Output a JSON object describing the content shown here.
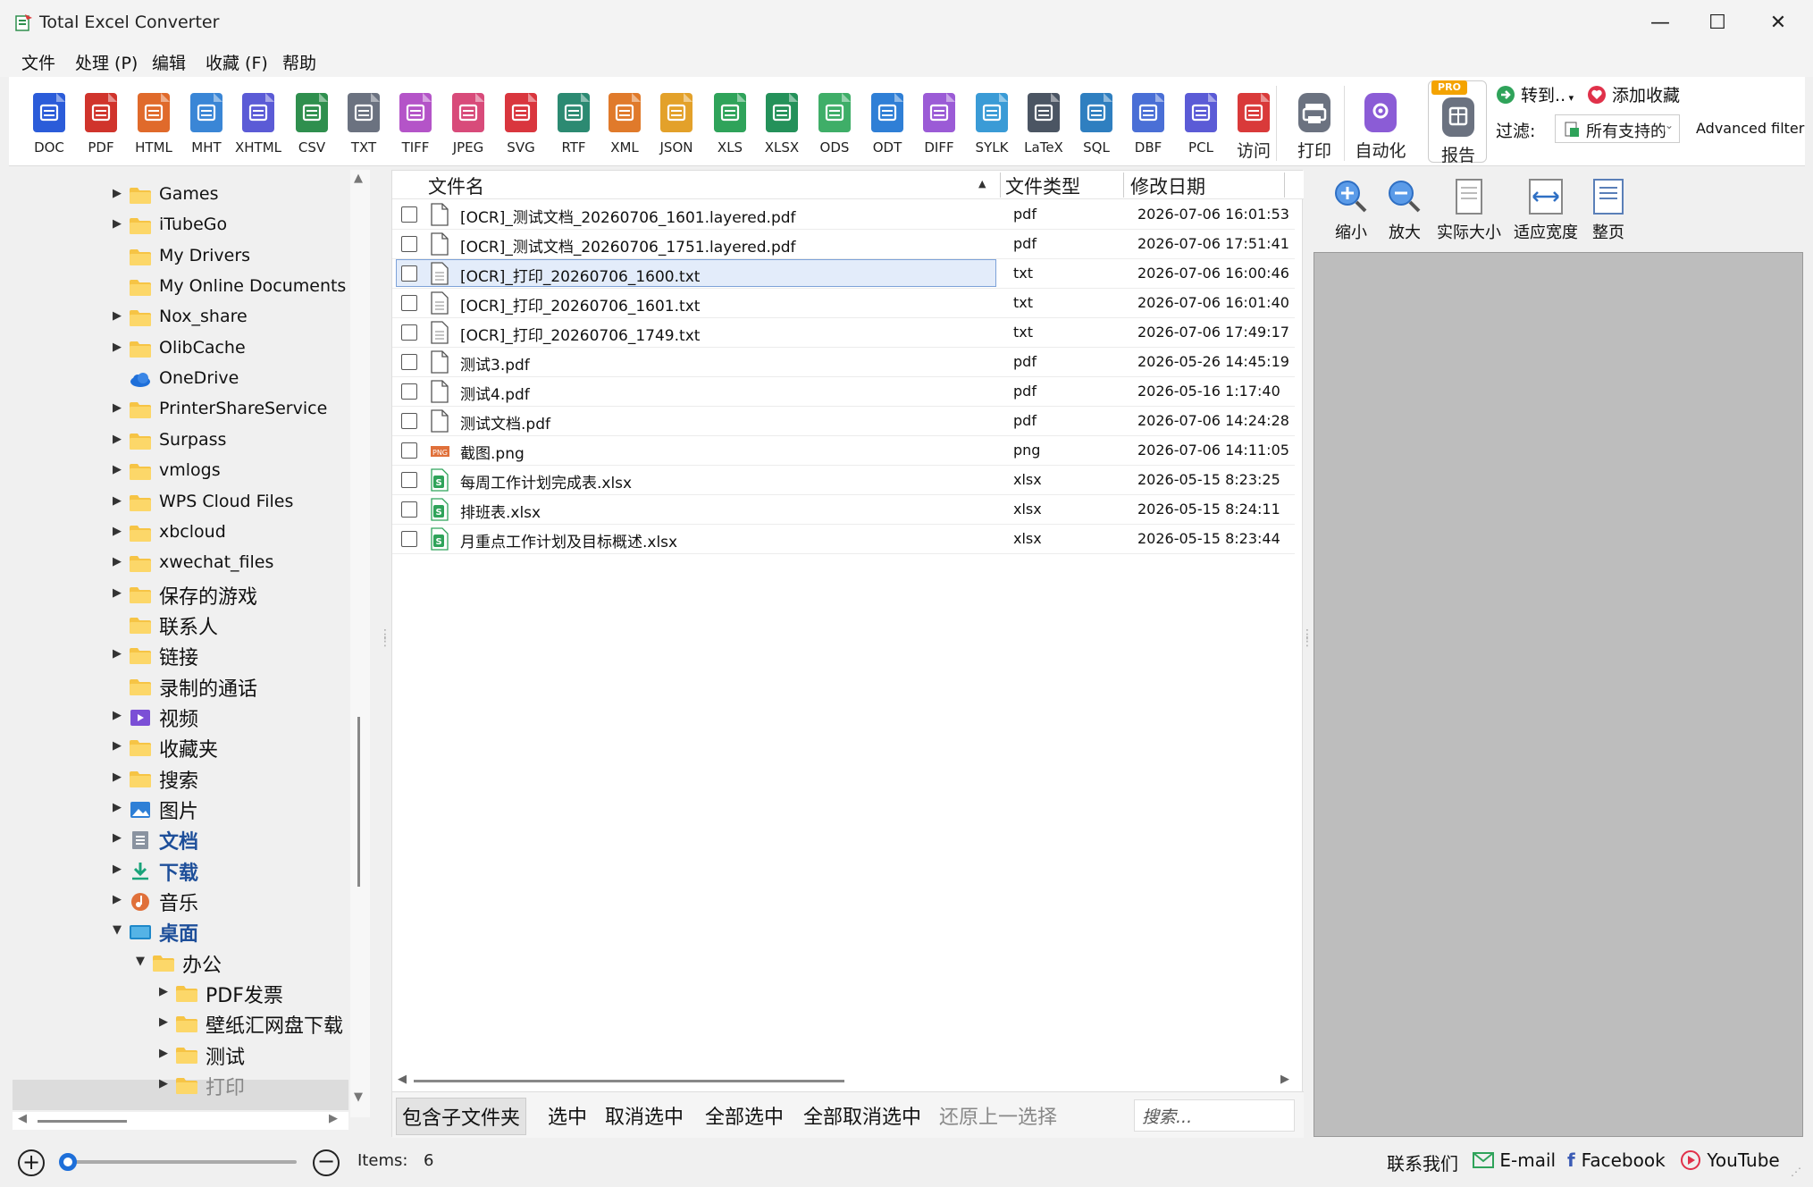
{
  "window": {
    "title": "Total Excel Converter",
    "minimize": "—",
    "maximize": "☐",
    "close": "✕"
  },
  "menu": [
    "文件",
    "处理 (P)",
    "编辑",
    "收藏 (F)",
    "帮助"
  ],
  "toolbar": {
    "formats": [
      {
        "label": "DOC",
        "color": "#2b5cd9",
        "icon": "doc-icon"
      },
      {
        "label": "PDF",
        "color": "#d0342c",
        "icon": "pdf-icon"
      },
      {
        "label": "HTML",
        "color": "#e06a2b",
        "icon": "html-icon"
      },
      {
        "label": "MHT",
        "color": "#3a86d6",
        "icon": "mht-icon"
      },
      {
        "label": "XHTML",
        "color": "#5b5bd6",
        "icon": "xhtml-icon"
      },
      {
        "label": "CSV",
        "color": "#2f8f4e",
        "icon": "csv-icon"
      },
      {
        "label": "TXT",
        "color": "#6b7280",
        "icon": "txt-icon"
      },
      {
        "label": "TIFF",
        "color": "#b454c8",
        "icon": "tiff-icon"
      },
      {
        "label": "JPEG",
        "color": "#d84b7a",
        "icon": "jpeg-icon"
      },
      {
        "label": "SVG",
        "color": "#d9363e",
        "icon": "svg-icon"
      },
      {
        "label": "RTF",
        "color": "#2c8a72",
        "icon": "rtf-icon"
      },
      {
        "label": "XML",
        "color": "#e07a2b",
        "icon": "xml-icon"
      },
      {
        "label": "JSON",
        "color": "#e3a12a",
        "icon": "json-icon"
      },
      {
        "label": "XLS",
        "color": "#2fa35a",
        "icon": "xls-icon"
      },
      {
        "label": "XLSX",
        "color": "#24915a",
        "icon": "xlsx-icon"
      },
      {
        "label": "ODS",
        "color": "#3fae68",
        "icon": "ods-icon"
      },
      {
        "label": "ODT",
        "color": "#2f7fd6",
        "icon": "odt-icon"
      },
      {
        "label": "DIFF",
        "color": "#9b5bd6",
        "icon": "diff-icon"
      },
      {
        "label": "SYLK",
        "color": "#3a9bd6",
        "icon": "sylk-icon"
      },
      {
        "label": "LaTeX",
        "color": "#4b5563",
        "icon": "latex-icon"
      },
      {
        "label": "SQL",
        "color": "#2f7fc0",
        "icon": "sql-icon"
      },
      {
        "label": "DBF",
        "color": "#4a6fd6",
        "icon": "dbf-icon"
      },
      {
        "label": "PCL",
        "color": "#5b5bd6",
        "icon": "pcl-icon"
      },
      {
        "label": "访问",
        "color": "#d93a3a",
        "icon": "access-icon"
      }
    ],
    "print": {
      "label": "打印",
      "color": "#6b7280"
    },
    "automate": {
      "label": "自动化",
      "color": "#8b5cd6"
    },
    "report": {
      "label": "报告",
      "color": "#6b7280",
      "badge": "PRO"
    },
    "goto": "转到..",
    "add_favorite": "添加收藏",
    "filter_label": "过滤:",
    "filter_value": "所有支持的",
    "advanced_filter": "Advanced filter"
  },
  "tree": {
    "items": [
      {
        "label": "Games",
        "arrow": "▶",
        "icon": "folder-icon",
        "indent": 0,
        "zh": false
      },
      {
        "label": "iTubeGo",
        "arrow": "▶",
        "icon": "folder-icon",
        "indent": 0,
        "zh": false
      },
      {
        "label": "My Drivers",
        "arrow": "",
        "icon": "folder-icon",
        "indent": 0,
        "zh": false
      },
      {
        "label": "My Online Documents",
        "arrow": "",
        "icon": "folder-icon",
        "indent": 0,
        "zh": false
      },
      {
        "label": "Nox_share",
        "arrow": "▶",
        "icon": "folder-icon",
        "indent": 0,
        "zh": false
      },
      {
        "label": "OlibCache",
        "arrow": "▶",
        "icon": "folder-icon",
        "indent": 0,
        "zh": false
      },
      {
        "label": "OneDrive",
        "arrow": "",
        "icon": "cloud-icon",
        "indent": 0,
        "zh": false
      },
      {
        "label": "PrinterShareService",
        "arrow": "▶",
        "icon": "folder-icon",
        "indent": 0,
        "zh": false
      },
      {
        "label": "Surpass",
        "arrow": "▶",
        "icon": "folder-icon",
        "indent": 0,
        "zh": false
      },
      {
        "label": "vmlogs",
        "arrow": "▶",
        "icon": "folder-icon",
        "indent": 0,
        "zh": false
      },
      {
        "label": "WPS Cloud Files",
        "arrow": "▶",
        "icon": "folder-icon",
        "indent": 0,
        "zh": false
      },
      {
        "label": "xbcloud",
        "arrow": "▶",
        "icon": "folder-icon",
        "indent": 0,
        "zh": false
      },
      {
        "label": "xwechat_files",
        "arrow": "▶",
        "icon": "folder-icon",
        "indent": 0,
        "zh": false
      },
      {
        "label": "保存的游戏",
        "arrow": "▶",
        "icon": "folder-icon",
        "indent": 0,
        "zh": true
      },
      {
        "label": "联系人",
        "arrow": "",
        "icon": "folder-icon",
        "indent": 0,
        "zh": true
      },
      {
        "label": "链接",
        "arrow": "▶",
        "icon": "folder-icon",
        "indent": 0,
        "zh": true
      },
      {
        "label": "录制的通话",
        "arrow": "",
        "icon": "folder-icon",
        "indent": 0,
        "zh": true
      },
      {
        "label": "视频",
        "arrow": "▶",
        "icon": "video-folder-icon",
        "indent": 0,
        "zh": true
      },
      {
        "label": "收藏夹",
        "arrow": "▶",
        "icon": "folder-icon",
        "indent": 0,
        "zh": true
      },
      {
        "label": "搜索",
        "arrow": "▶",
        "icon": "folder-icon",
        "indent": 0,
        "zh": true
      },
      {
        "label": "图片",
        "arrow": "▶",
        "icon": "pictures-folder-icon",
        "indent": 0,
        "zh": true
      },
      {
        "label": "文档",
        "arrow": "▶",
        "icon": "documents-folder-icon",
        "indent": 0,
        "zh": true,
        "blue": true
      },
      {
        "label": "下载",
        "arrow": "▶",
        "icon": "download-icon",
        "indent": 0,
        "zh": true,
        "blue": true
      },
      {
        "label": "音乐",
        "arrow": "▶",
        "icon": "music-folder-icon",
        "indent": 0,
        "zh": true
      },
      {
        "label": "桌面",
        "arrow": "▼",
        "icon": "desktop-folder-icon",
        "indent": 0,
        "zh": true,
        "blue": true
      },
      {
        "label": "办公",
        "arrow": "▼",
        "icon": "folder-icon",
        "indent": 1,
        "zh": true
      },
      {
        "label": "PDF发票",
        "arrow": "▶",
        "icon": "folder-icon",
        "indent": 2,
        "zh": true
      },
      {
        "label": "壁纸汇网盘下载",
        "arrow": "▶",
        "icon": "folder-icon",
        "indent": 2,
        "zh": true
      },
      {
        "label": "测试",
        "arrow": "▶",
        "icon": "folder-icon",
        "indent": 2,
        "zh": true
      },
      {
        "label": "打印",
        "arrow": "▶",
        "icon": "folder-icon",
        "indent": 2,
        "zh": true,
        "selected": true
      }
    ]
  },
  "files": {
    "columns": {
      "name": "文件名",
      "type": "文件类型",
      "date": "修改日期"
    },
    "rows": [
      {
        "name": "[OCR]_测试文档_20260706_1601.layered.pdf",
        "type": "pdf",
        "date": "2026-07-06 16:01:53",
        "icon": "pdf"
      },
      {
        "name": "[OCR]_测试文档_20260706_1751.layered.pdf",
        "type": "pdf",
        "date": "2026-07-06 17:51:41",
        "icon": "pdf"
      },
      {
        "name": "[OCR]_打印_20260706_1600.txt",
        "type": "txt",
        "date": "2026-07-06 16:00:46",
        "icon": "txt",
        "selected": true
      },
      {
        "name": "[OCR]_打印_20260706_1601.txt",
        "type": "txt",
        "date": "2026-07-06 16:01:40",
        "icon": "txt"
      },
      {
        "name": "[OCR]_打印_20260706_1749.txt",
        "type": "txt",
        "date": "2026-07-06 17:49:17",
        "icon": "txt"
      },
      {
        "name": "测试3.pdf",
        "type": "pdf",
        "date": "2026-05-26 14:45:19",
        "icon": "pdf"
      },
      {
        "name": "测试4.pdf",
        "type": "pdf",
        "date": "2026-05-16 1:17:40",
        "icon": "pdf"
      },
      {
        "name": "测试文档.pdf",
        "type": "pdf",
        "date": "2026-07-06 14:24:28",
        "icon": "pdf"
      },
      {
        "name": "截图.png",
        "type": "png",
        "date": "2026-07-06 14:11:05",
        "icon": "png"
      },
      {
        "name": "每周工作计划完成表.xlsx",
        "type": "xlsx",
        "date": "2026-05-15 8:23:25",
        "icon": "xlsx"
      },
      {
        "name": "排班表.xlsx",
        "type": "xlsx",
        "date": "2026-05-15 8:24:11",
        "icon": "xlsx"
      },
      {
        "name": "月重点工作计划及目标概述.xlsx",
        "type": "xlsx",
        "date": "2026-05-15 8:23:44",
        "icon": "xlsx"
      }
    ],
    "bottom": {
      "include_sub": "包含子文件夹",
      "select": "选中",
      "deselect": "取消选中",
      "select_all": "全部选中",
      "deselect_all": "全部取消选中",
      "restore": "还原上一选择",
      "search_placeholder": "搜索..."
    }
  },
  "preview": {
    "buttons": [
      "缩小",
      "放大",
      "实际大小",
      "适应宽度",
      "整页"
    ]
  },
  "status": {
    "items_label": "Items:",
    "items_count": "6",
    "contact": "联系我们",
    "email": "E-mail",
    "facebook": "Facebook",
    "youtube": "YouTube"
  }
}
